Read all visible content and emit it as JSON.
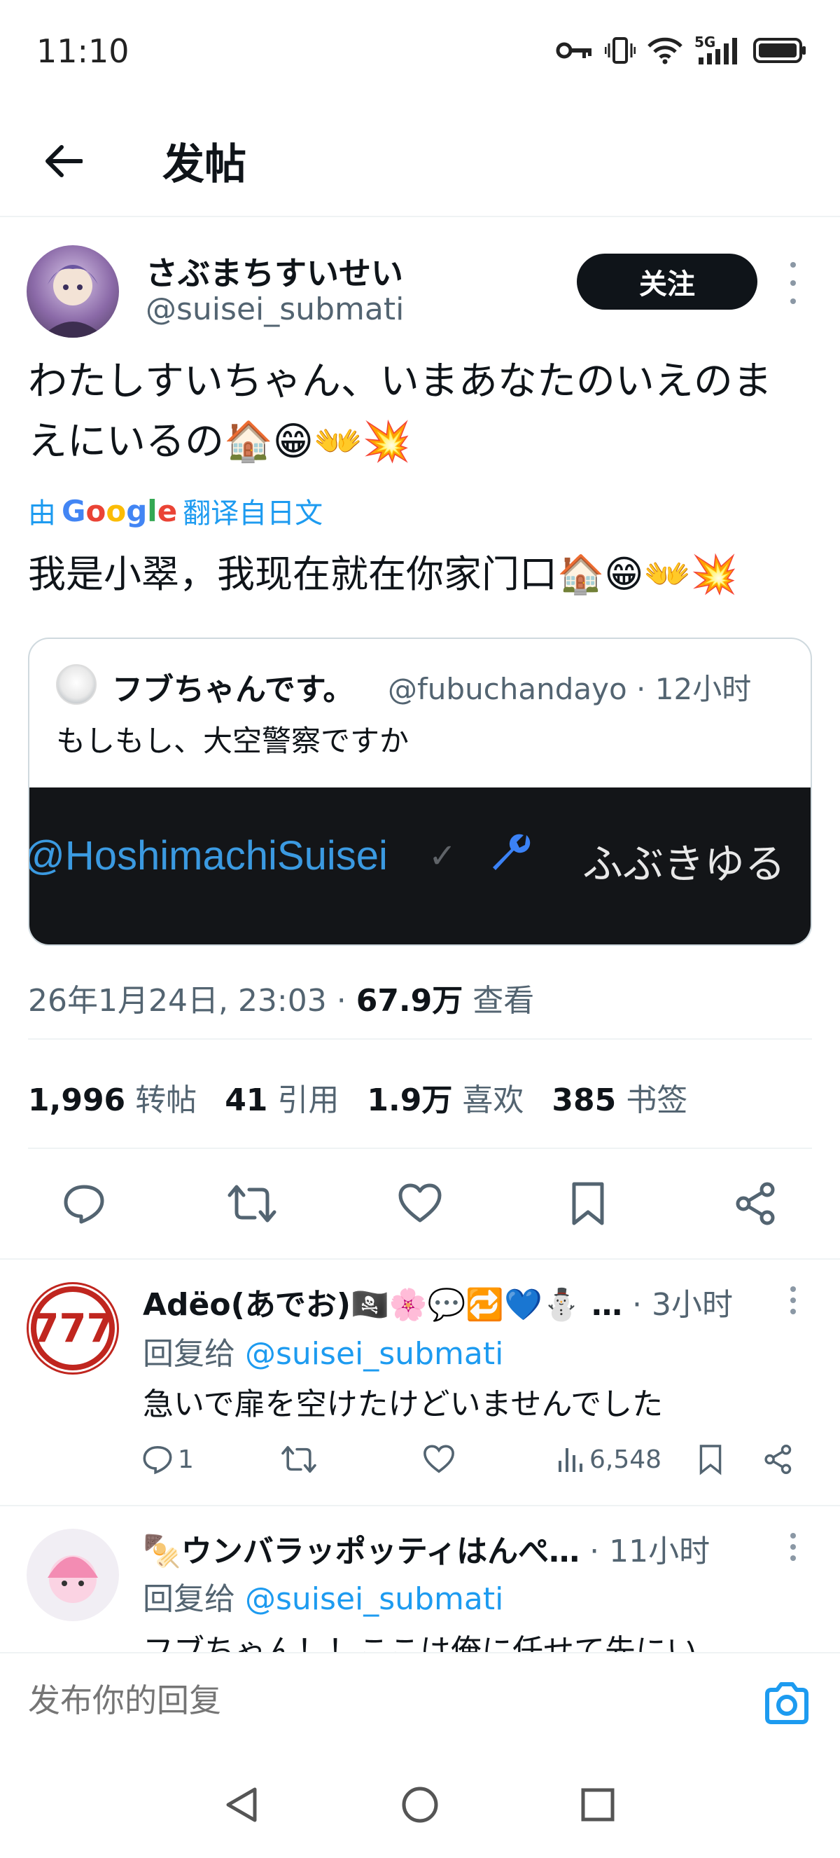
{
  "status_bar": {
    "time": "11:10",
    "network": "5G"
  },
  "header": {
    "title": "发帖"
  },
  "tweet": {
    "author_name": "さぶまちすいせい",
    "author_handle": "@suisei_submati",
    "follow_label": "关注",
    "text_line1": "わたしすいちゃん、いまあなたのいえのま",
    "text_line2": "えにいるの🏠😁👐💥",
    "translate_prefix": "由",
    "translate_brand": "Google",
    "translate_suffix": "翻译自日文",
    "translated_text": "我是小翠，我现在就在你家门口🏠😁👐💥",
    "quote": {
      "name": "フブちゃんです。",
      "meta": "@fubuchandayo · 12小时",
      "text": "もしもし、大空警察ですか",
      "media_handle": "@HoshimachiSuisei",
      "media_check": "✓",
      "media_jp": "ふぶきゆる"
    },
    "timestamp_prefix": "26年1月24日, 23:03 · ",
    "views_count": "67.9万",
    "views_label": " 查看",
    "stats": {
      "reposts_count": "1,996",
      "reposts_label": "转帖",
      "quotes_count": "41",
      "quotes_label": "引用",
      "likes_count": "1.9万",
      "likes_label": "喜欢",
      "bookmarks_count": "385",
      "bookmarks_label": "书签"
    }
  },
  "replies": [
    {
      "name": "Adëo(あでお)🏴‍☠️🌸💬🔁💙⛄ …",
      "meta": " · 3小时",
      "reply_to_label": "回复给 ",
      "reply_to_handle": "@suisei_submati",
      "text": "急いで扉を空けたけどいませんでした",
      "reply_count": "1",
      "views": "6,548"
    },
    {
      "name": "🍢ウンバラッポッティはんぺ…",
      "meta": " · 11小时",
      "reply_to_label": "回复给 ",
      "reply_to_handle": "@suisei_submati",
      "text": "フブちゃん！！ここは俺に任せて先にい"
    }
  ],
  "compose": {
    "placeholder": "发布你的回复"
  },
  "colors": {
    "accent": "#1d9bf0",
    "text": "#0f1419",
    "muted": "#536471",
    "border": "#eff3f4"
  }
}
